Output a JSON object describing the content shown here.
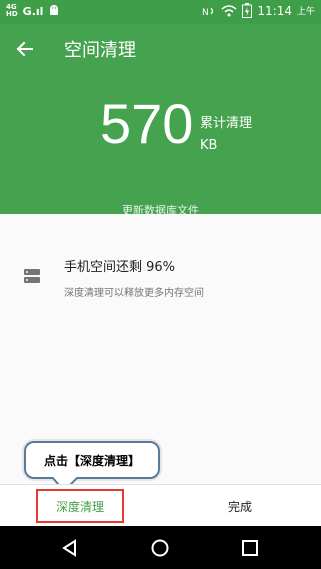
{
  "status_bar": {
    "carrier_top": "4G",
    "carrier_bottom": "HD",
    "signal": "G.ıl",
    "time": "11:14",
    "ampm": "上午"
  },
  "header": {
    "title": "空间清理",
    "cleaned_value": "570",
    "cleaned_label": "累计清理",
    "cleaned_unit": "KB",
    "update_link": "更新数据库文件"
  },
  "storage": {
    "title": "手机空间还剩 96%",
    "subtitle": "深度清理可以释放更多内存空间"
  },
  "callout": {
    "text": "点击【深度清理】"
  },
  "bottom_bar": {
    "deep_clean_label": "深度清理",
    "done_label": "完成"
  },
  "colors": {
    "accent": "#45a24e",
    "status_bar": "#3f9e48",
    "highlight": "#e53935"
  }
}
